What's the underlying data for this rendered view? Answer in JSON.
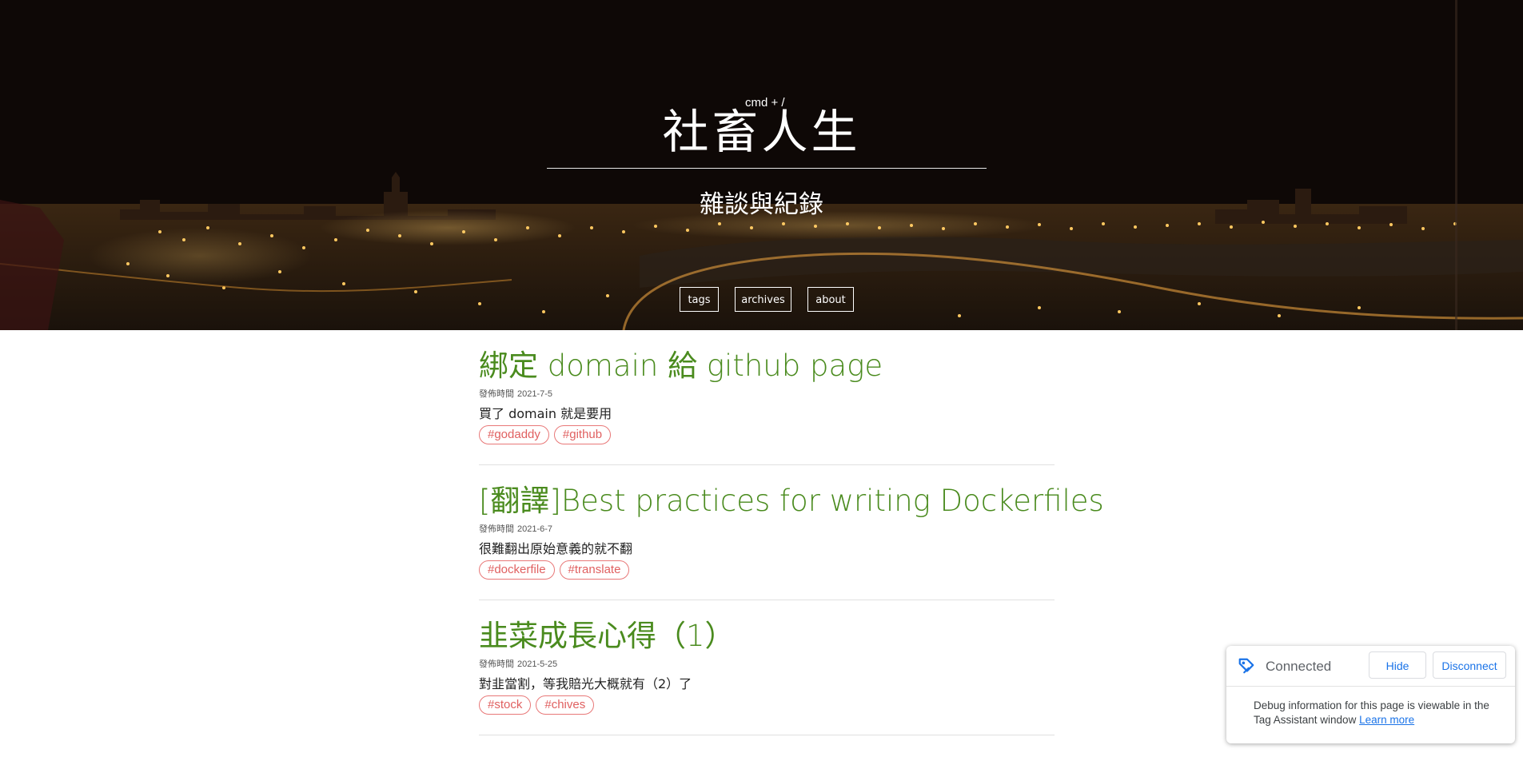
{
  "hero": {
    "title": "社畜人生",
    "shortcut_hint": "cmd + /",
    "subtitle": "雜談與紀錄",
    "nav": [
      {
        "label": "tags"
      },
      {
        "label": "archives"
      },
      {
        "label": "about"
      }
    ]
  },
  "posts": [
    {
      "title": "綁定 domain 給 github page",
      "date_label": "發佈時間",
      "date": "2021-7-5",
      "excerpt": "買了 domain 就是要用",
      "tags": [
        "#godaddy",
        "#github"
      ]
    },
    {
      "title": "[翻譯]Best practices for writing Dockerfiles",
      "date_label": "發佈時間",
      "date": "2021-6-7",
      "excerpt": "很難翻出原始意義的就不翻",
      "tags": [
        "#dockerfile",
        "#translate"
      ]
    },
    {
      "title": "韭菜成長心得（1）",
      "date_label": "發佈時間",
      "date": "2021-5-25",
      "excerpt": "對韭當割，等我賠光大概就有（2）了",
      "tags": [
        "#stock",
        "#chives"
      ]
    }
  ],
  "tag_assistant": {
    "status": "Connected",
    "hide_label": "Hide",
    "disconnect_label": "Disconnect",
    "message": "Debug information for this page is viewable in the Tag Assistant window",
    "link_label": "Learn more",
    "accent_color": "#1a73e8"
  },
  "colors": {
    "post_title": "#4a8b1e",
    "tag": "#e06060"
  }
}
